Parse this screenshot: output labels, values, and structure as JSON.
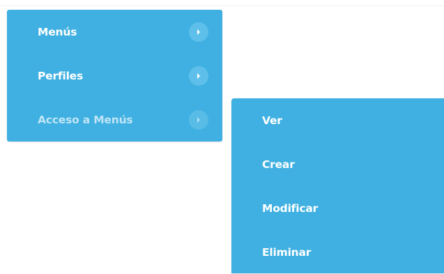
{
  "main_menu": {
    "items": [
      {
        "label": "Menús",
        "state": "normal"
      },
      {
        "label": "Perfiles",
        "state": "normal"
      },
      {
        "label": "Acceso a Menús",
        "state": "active"
      }
    ],
    "arrow_icon": "chevron-right-circle-icon",
    "background_color": "#3fb0e1"
  },
  "submenu": {
    "items": [
      {
        "label": "Ver"
      },
      {
        "label": "Crear"
      },
      {
        "label": "Modificar"
      },
      {
        "label": "Eliminar"
      }
    ],
    "background_color": "#3fb0e1"
  }
}
